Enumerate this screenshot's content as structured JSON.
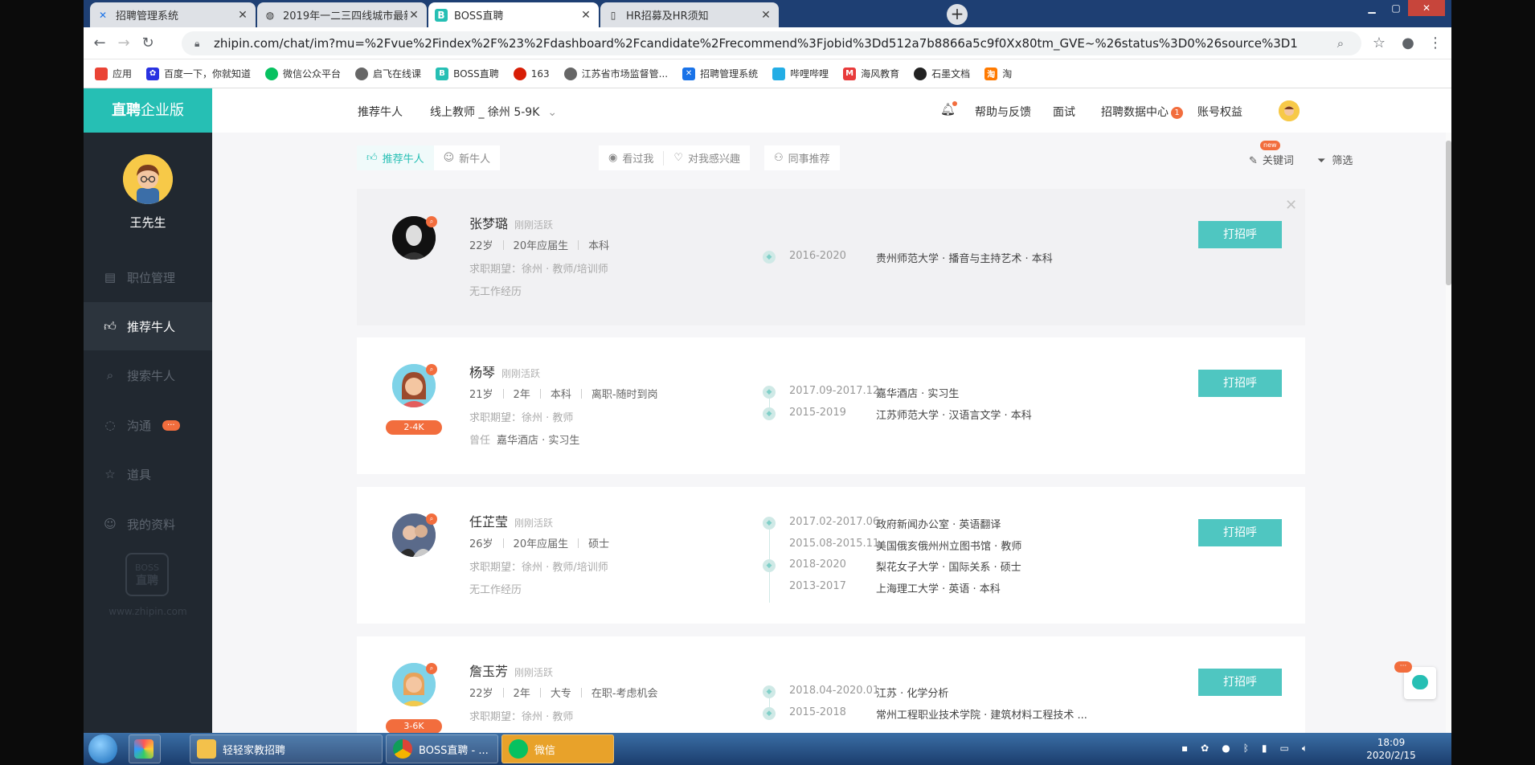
{
  "browser": {
    "tabs": [
      {
        "title": "招聘管理系统",
        "icon": "x-logo-icon"
      },
      {
        "title": "2019年一二三四线城市最新排名",
        "icon": "globe-icon"
      },
      {
        "title": "BOSS直聘",
        "icon": "boss-logo-icon"
      },
      {
        "title": "HR招募及HR须知",
        "icon": "doc-icon"
      }
    ],
    "url": "zhipin.com/chat/im?mu=%2Fvue%2Findex%2F%23%2Fdashboard%2Fcandidate%2Frecommend%3Fjobid%3Dd512a7b8866a5c9f0Xx80tm_GVE~%26status%3D0%26source%3D1",
    "bookmarks": [
      "应用",
      "百度一下，你就知道",
      "微信公众平台",
      "启飞在线课",
      "BOSS直聘",
      "163",
      "江苏省市场监督管...",
      "招聘管理系统",
      "哔哩哔哩",
      "海风教育",
      "石墨文档",
      "淘"
    ]
  },
  "sidebar": {
    "brand_bold": "直聘",
    "brand_rest": "企业版",
    "user_name": "王先生",
    "items": [
      {
        "label": "职位管理",
        "icon": "briefcase-icon"
      },
      {
        "label": "推荐牛人",
        "icon": "thumbs-up-icon"
      },
      {
        "label": "搜索牛人",
        "icon": "search-icon"
      },
      {
        "label": "沟通",
        "icon": "chat-icon",
        "badge": "···"
      },
      {
        "label": "道具",
        "icon": "gift-icon"
      },
      {
        "label": "我的资料",
        "icon": "user-icon"
      }
    ],
    "logo_top": "BOSS",
    "logo_bottom": "直聘",
    "site_url": "www.zhipin.com"
  },
  "topnav": {
    "section": "推荐牛人",
    "job": "线上教师 _ 徐州 5-9K",
    "help": "帮助与反馈",
    "interview": "面试",
    "data_center": "招聘数据中心",
    "data_center_count": "1",
    "account": "账号权益"
  },
  "subtabs": {
    "recommend": "推荐牛人",
    "new": "新牛人",
    "viewed": "看过我",
    "interested": "对我感兴趣",
    "colleague": "同事推荐",
    "keyword": "关键词",
    "keyword_badge": "new",
    "filter": "筛选"
  },
  "candidates": [
    {
      "name": "张梦璐",
      "active": "刚刚活跃",
      "meta": [
        "22岁",
        "20年应届生",
        "本科"
      ],
      "expect": "徐州 · 教师/培训师",
      "expect_label": "求职期望：",
      "extra": "无工作经历",
      "greet": "打招呼",
      "timeline": [
        {
          "date": "2016-2020",
          "text": "贵州师范大学 · 播音与主持艺术 · 本科",
          "icon": "graduation-icon"
        }
      ]
    },
    {
      "name": "杨琴",
      "active": "刚刚活跃",
      "salary": "2-4K",
      "meta": [
        "21岁",
        "2年",
        "本科",
        "离职-随时到岗"
      ],
      "expect": "徐州 · 教师",
      "expect_label": "求职期望：",
      "extra_label": "曾任",
      "extra": "嘉华酒店 · 实习生",
      "greet": "打招呼",
      "timeline": [
        {
          "date": "2017.09-2017.12",
          "text": "嘉华酒店 · 实习生",
          "icon": "briefcase-icon"
        },
        {
          "date": "2015-2019",
          "text": "江苏师范大学 · 汉语言文学 · 本科",
          "icon": "graduation-icon"
        }
      ]
    },
    {
      "name": "任芷莹",
      "active": "刚刚活跃",
      "meta": [
        "26岁",
        "20年应届生",
        "硕士"
      ],
      "expect": "徐州 · 教师/培训师",
      "expect_label": "求职期望：",
      "extra": "无工作经历",
      "greet": "打招呼",
      "timeline": [
        {
          "date": "2017.02-2017.06",
          "text": "政府新闻办公室 · 英语翻译",
          "icon": "briefcase-icon"
        },
        {
          "date": "2015.08-2015.11",
          "text": "美国俄亥俄州州立图书馆 · 教师",
          "icon": ""
        },
        {
          "date": "2018-2020",
          "text": "梨花女子大学 · 国际关系 · 硕士",
          "icon": "graduation-icon"
        },
        {
          "date": "2013-2017",
          "text": "上海理工大学 · 英语 · 本科",
          "icon": ""
        }
      ]
    },
    {
      "name": "詹玉芳",
      "active": "刚刚活跃",
      "salary": "3-6K",
      "meta": [
        "22岁",
        "2年",
        "大专",
        "在职-考虑机会"
      ],
      "expect": "徐州 · 教师",
      "expect_label": "求职期望：",
      "greet": "打招呼",
      "timeline": [
        {
          "date": "2018.04-2020.01",
          "text": "江苏 · 化学分析",
          "icon": "briefcase-icon"
        },
        {
          "date": "2015-2018",
          "text": "常州工程职业技术学院 · 建筑材料工程技术 ...",
          "icon": "graduation-icon"
        }
      ]
    }
  ],
  "taskbar": {
    "items": [
      "轻轻家教招聘",
      "BOSS直聘 - ...",
      "微信"
    ],
    "time": "18:09",
    "date": "2020/2/15"
  },
  "colors": {
    "accent": "#26bfb4",
    "orange": "#f26d3d",
    "sidebar": "#212830"
  }
}
